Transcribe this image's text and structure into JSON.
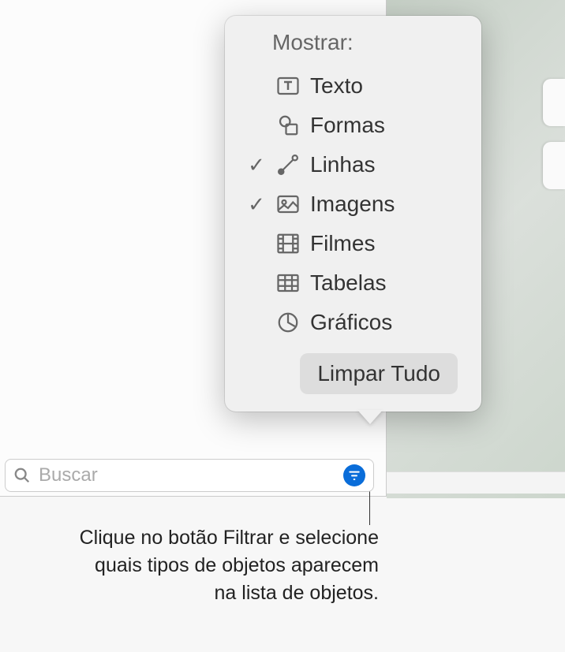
{
  "popover": {
    "title": "Mostrar:",
    "items": [
      {
        "label": "Texto",
        "checked": false
      },
      {
        "label": "Formas",
        "checked": false
      },
      {
        "label": "Linhas",
        "checked": true
      },
      {
        "label": "Imagens",
        "checked": true
      },
      {
        "label": "Filmes",
        "checked": false
      },
      {
        "label": "Tabelas",
        "checked": false
      },
      {
        "label": "Gráficos",
        "checked": false
      }
    ],
    "clear_label": "Limpar Tudo"
  },
  "search": {
    "placeholder": "Buscar"
  },
  "caption": {
    "line1": "Clique no botão Filtrar e selecione",
    "line2": "quais tipos de objetos aparecem",
    "line3": "na lista de objetos."
  }
}
